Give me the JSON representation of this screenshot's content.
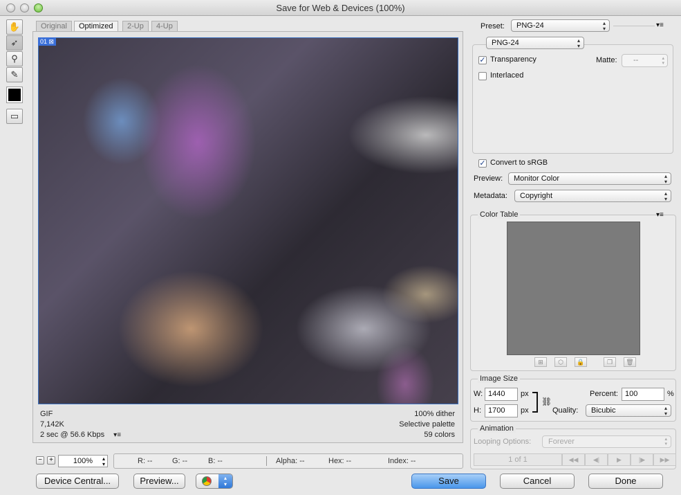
{
  "window": {
    "title": "Save for Web & Devices (100%)"
  },
  "tabs": [
    "Original",
    "Optimized",
    "2-Up",
    "4-Up"
  ],
  "image_label": "01",
  "image_info": {
    "format": "GIF",
    "size": "7,142K",
    "time": "2 sec @ 56.6 Kbps",
    "dither": "100% dither",
    "palette": "Selective palette",
    "colors": "59 colors"
  },
  "zoom": "100%",
  "readouts": {
    "r": "R: --",
    "g": "G: --",
    "b": "B: --",
    "alpha": "Alpha: --",
    "hex": "Hex: --",
    "index": "Index: --"
  },
  "buttons": {
    "device_central": "Device Central...",
    "preview": "Preview...",
    "save": "Save",
    "cancel": "Cancel",
    "done": "Done"
  },
  "settings": {
    "preset_label": "Preset:",
    "preset_value": "PNG-24",
    "format_value": "PNG-24",
    "transparency_label": "Transparency",
    "transparency_checked": true,
    "matte_label": "Matte:",
    "matte_value": "--",
    "interlaced_label": "Interlaced",
    "interlaced_checked": false,
    "convert_label": "Convert to sRGB",
    "convert_checked": true,
    "preview_label": "Preview:",
    "preview_value": "Monitor Color",
    "metadata_label": "Metadata:",
    "metadata_value": "Copyright"
  },
  "color_table": {
    "title": "Color Table"
  },
  "image_size": {
    "title": "Image Size",
    "w_label": "W:",
    "w_value": "1440",
    "h_label": "H:",
    "h_value": "1700",
    "unit": "px",
    "percent_label": "Percent:",
    "percent_value": "100",
    "percent_unit": "%",
    "quality_label": "Quality:",
    "quality_value": "Bicubic"
  },
  "animation": {
    "title": "Animation",
    "looping_label": "Looping Options:",
    "looping_value": "Forever",
    "frame_counter": "1 of 1"
  }
}
